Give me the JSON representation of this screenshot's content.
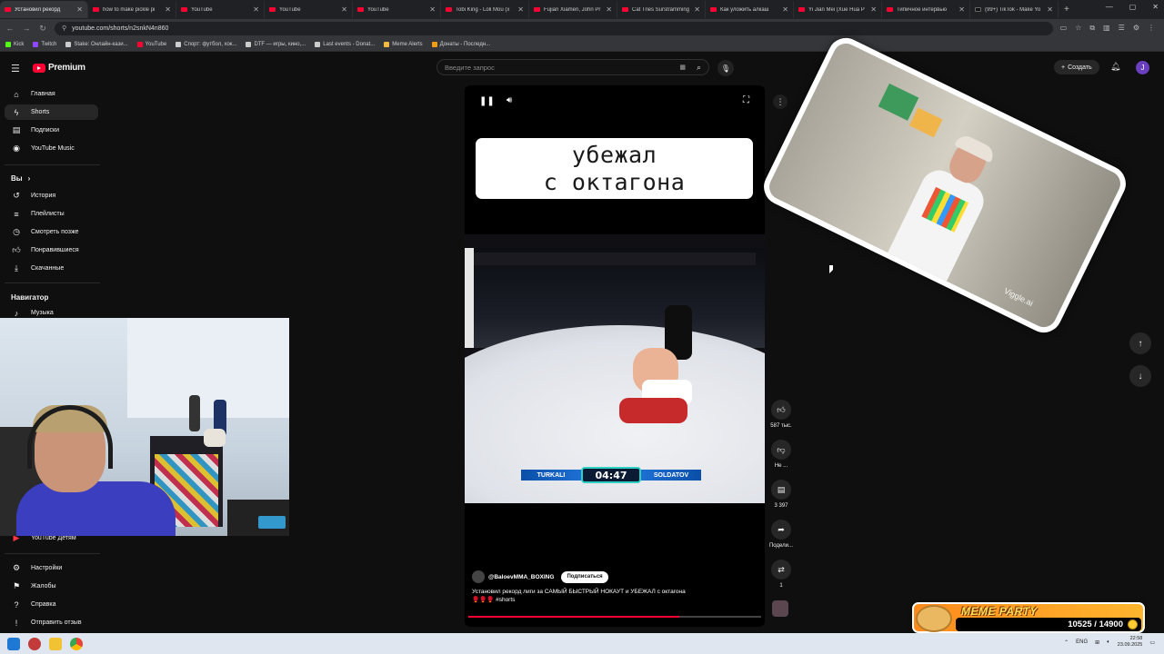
{
  "browser": {
    "tabs": [
      {
        "label": "Установил рекорд",
        "active": true,
        "icon": "youtube-favicon"
      },
      {
        "label": "how to make pickle pi",
        "active": false,
        "icon": "youtube-favicon"
      },
      {
        "label": "YouTube",
        "active": false,
        "icon": "youtube-favicon"
      },
      {
        "label": "YouTube",
        "active": false,
        "icon": "youtube-favicon"
      },
      {
        "label": "YouTube",
        "active": false,
        "icon": "youtube-favicon"
      },
      {
        "label": "Tobi King - Loli Mou (x",
        "active": false,
        "icon": "youtube-favicon"
      },
      {
        "label": "Fujian Xiamen, John Pr",
        "active": false,
        "icon": "youtube-favicon"
      },
      {
        "label": "Cat Tries Sursträmming",
        "active": false,
        "icon": "youtube-favicon"
      },
      {
        "label": "Как уложить алкаш",
        "active": false,
        "icon": "youtube-favicon"
      },
      {
        "label": "Yi Jian Mei (Xue Hua P",
        "active": false,
        "icon": "youtube-favicon"
      },
      {
        "label": "Типичное интервью",
        "active": false,
        "icon": "youtube-favicon"
      },
      {
        "label": "(99+) TikTok - Make Yo",
        "active": false,
        "icon": "tiktok-favicon"
      }
    ],
    "url": "youtube.com/shorts/n2snkN4n860",
    "bookmarks": [
      {
        "label": "Kick",
        "color": "#53fc18"
      },
      {
        "label": "Twitch",
        "color": "#9146ff"
      },
      {
        "label": "Stake: Онлайн-кази...",
        "color": "#cccccc"
      },
      {
        "label": "YouTube",
        "color": "#ff0033"
      },
      {
        "label": "Спорт: футбол, хок...",
        "color": "#cccccc"
      },
      {
        "label": "DTF — игры, кино,...",
        "color": "#cccccc"
      },
      {
        "label": "Last events - Donat...",
        "color": "#cccccc"
      },
      {
        "label": "Meme Alerts",
        "color": "#f5b942"
      },
      {
        "label": "Донаты - Последн...",
        "color": "#f39c12"
      }
    ]
  },
  "youtube": {
    "logo_text": "Premium",
    "search_placeholder": "Введите запрос",
    "create_label": "Создать",
    "avatar_letter": "J",
    "sidebar": {
      "main": [
        {
          "label": "Главная",
          "icon": "home-icon",
          "active": false
        },
        {
          "label": "Shorts",
          "icon": "shorts-icon",
          "active": true
        },
        {
          "label": "Подписки",
          "icon": "subscriptions-icon",
          "active": false
        },
        {
          "label": "YouTube Music",
          "icon": "music-icon",
          "active": false
        }
      ],
      "you_heading": "Вы",
      "you": [
        {
          "label": "История",
          "icon": "history-icon"
        },
        {
          "label": "Плейлисты",
          "icon": "playlist-icon"
        },
        {
          "label": "Смотреть позже",
          "icon": "watch-later-icon"
        },
        {
          "label": "Понравившиеся",
          "icon": "like-icon"
        },
        {
          "label": "Скачанные",
          "icon": "download-icon"
        }
      ],
      "navigator_heading": "Навигатор",
      "navigator": [
        {
          "label": "Музыка",
          "icon": "music-note-icon"
        }
      ],
      "kids": {
        "label": "YouTube Детям",
        "icon": "youtube-kids-icon"
      },
      "bottom": [
        {
          "label": "Настройки",
          "icon": "settings-icon"
        },
        {
          "label": "Жалобы",
          "icon": "flag-icon"
        },
        {
          "label": "Справка",
          "icon": "help-icon"
        },
        {
          "label": "Отправить отзыв",
          "icon": "feedback-icon"
        }
      ]
    },
    "short": {
      "caption_line1": "убежал",
      "caption_line2": "с октагона",
      "fighter_left": "TURKALI",
      "fighter_right": "SOLDATOV",
      "fight_clock": "04:47",
      "channel": "@BalоevMMA_BOXING",
      "subscribe_label": "Подписаться",
      "title": "Установил рекорд лиги за САМЫЙ БЫСТРЫЙ НОКАУТ и УБЕЖАЛ с октагона🥊🥊🥊 #shorts",
      "progress_fraction": 0.72,
      "actions": [
        {
          "icon": "thumbs-up-icon",
          "label": "587 тыс."
        },
        {
          "icon": "thumbs-down-icon",
          "label": "Не ..."
        },
        {
          "icon": "comment-icon",
          "label": "3 397"
        },
        {
          "icon": "share-icon",
          "label": "Подели..."
        },
        {
          "icon": "remix-icon",
          "label": "1"
        }
      ]
    },
    "overlay_watermark": "Viggle.ai"
  },
  "widget": {
    "title": "MEME PARTY",
    "value": "10525 / 14900"
  },
  "taskbar": {
    "lang": "ENG",
    "time": "22:58",
    "date": "23.09.2025"
  }
}
